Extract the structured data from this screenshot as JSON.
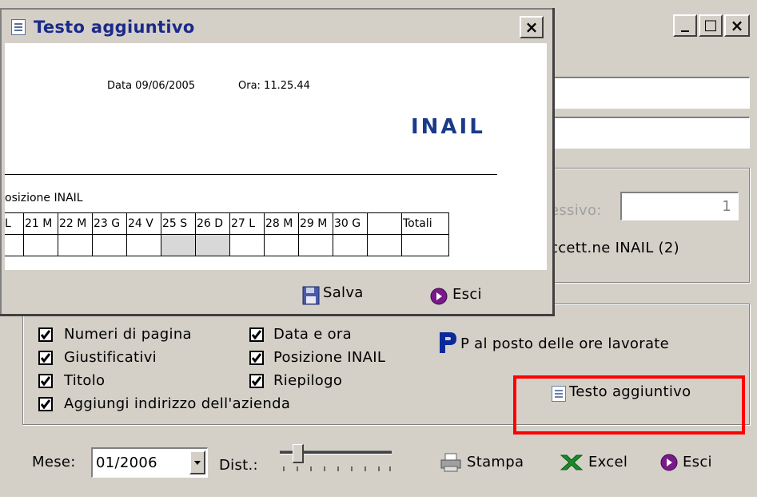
{
  "main_window": {
    "title_buttons": [
      "_",
      "□",
      "×"
    ],
    "progressive_label": "essivo:",
    "progressive_value": "1",
    "accett_label": "ccett.ne INAIL (2)",
    "options": {
      "numeri_pagina": "Numeri di pagina",
      "data_ora": "Data e ora",
      "giustificativi": "Giustificativi",
      "posizione_inail": "Posizione INAIL",
      "titolo": "Titolo",
      "riepilogo": "Riepilogo",
      "aggiungi_indirizzo": "Aggiungi indirizzo dell'azienda",
      "p_label": "P al posto delle ore lavorate",
      "testo_aggiuntivo": "Testo aggiuntivo"
    },
    "bottom": {
      "mese_label": "Mese:",
      "mese_value": "01/2006",
      "dist_label": "Dist.:",
      "stampa": "Stampa",
      "excel": "Excel",
      "esci": "Esci"
    },
    "colors": {
      "highlight": "#ff0000",
      "face": "#d4d0c8"
    }
  },
  "popup": {
    "title": "Testo aggiuntivo",
    "close": "×",
    "doc": {
      "date": "Data 09/06/2005",
      "time": "Ora: 11.25.44",
      "logo": "INAIL",
      "section": "osizione INAIL",
      "days": [
        "L",
        "21 M",
        "22 M",
        "23 G",
        "24 V",
        "25 S",
        "26 D",
        "27 L",
        "28 M",
        "29 M",
        "30 G",
        "",
        "Totali"
      ]
    },
    "salva": "Salva",
    "esci": "Esci"
  }
}
